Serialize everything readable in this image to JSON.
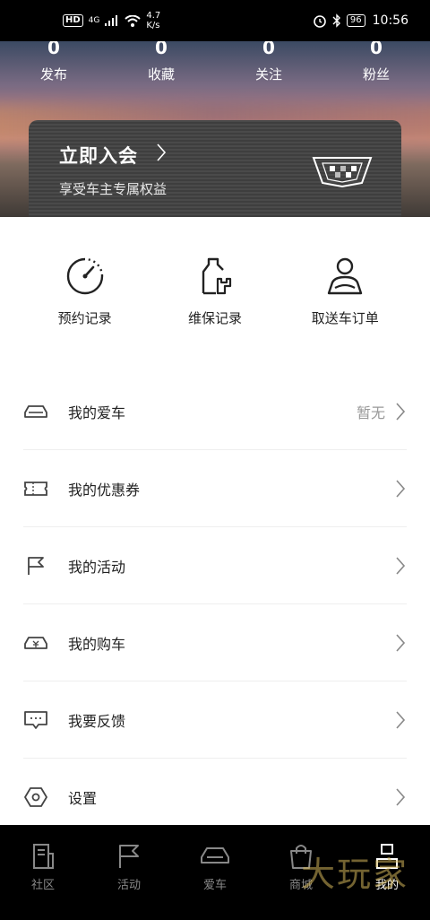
{
  "status_bar": {
    "hd": "HD",
    "network": "4G",
    "speed_value": "4.7",
    "speed_unit": "K/s",
    "battery": "96",
    "time": "10:56"
  },
  "stats": [
    {
      "value": "0",
      "label": "发布"
    },
    {
      "value": "0",
      "label": "收藏"
    },
    {
      "value": "0",
      "label": "关注"
    },
    {
      "value": "0",
      "label": "粉丝"
    }
  ],
  "join_card": {
    "title": "立即入会",
    "subtitle": "享受车主专属权益"
  },
  "quick_actions": [
    {
      "label": "预约记录",
      "icon": "gauge-icon"
    },
    {
      "label": "维保记录",
      "icon": "oil-wrench-icon"
    },
    {
      "label": "取送车订单",
      "icon": "driver-icon"
    }
  ],
  "menu": [
    {
      "label": "我的爱车",
      "value": "暂无",
      "icon": "car-icon"
    },
    {
      "label": "我的优惠券",
      "value": "",
      "icon": "ticket-icon"
    },
    {
      "label": "我的活动",
      "value": "",
      "icon": "flag-icon"
    },
    {
      "label": "我的购车",
      "value": "",
      "icon": "car-purchase-icon"
    },
    {
      "label": "我要反馈",
      "value": "",
      "icon": "message-icon"
    },
    {
      "label": "设置",
      "value": "",
      "icon": "settings-icon"
    }
  ],
  "bottom_nav": [
    {
      "label": "社区",
      "icon": "community-icon"
    },
    {
      "label": "活动",
      "icon": "flag-icon"
    },
    {
      "label": "爱车",
      "icon": "car-icon"
    },
    {
      "label": "商城",
      "icon": "shopping-bag-icon"
    },
    {
      "label": "我的",
      "icon": "profile-icon",
      "active": true
    }
  ],
  "watermark": "大玩家"
}
